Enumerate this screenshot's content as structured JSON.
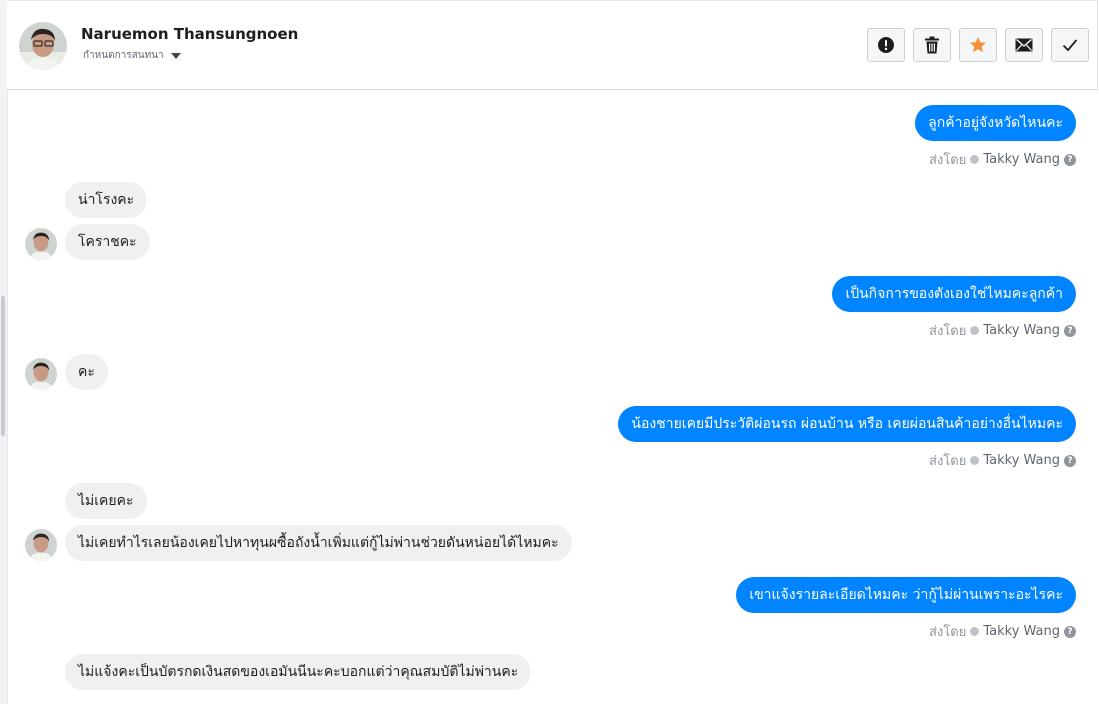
{
  "header": {
    "contact_name": "Naruemon Thansungnoen",
    "assign_label": "กำหนดการสนทนา",
    "actions": [
      {
        "name": "spam",
        "icon": "alert-circle-icon"
      },
      {
        "name": "delete",
        "icon": "trash-icon"
      },
      {
        "name": "star",
        "icon": "star-icon",
        "color": "#f7923b"
      },
      {
        "name": "mark-unread",
        "icon": "envelope-icon"
      },
      {
        "name": "done",
        "icon": "checkmark-icon"
      }
    ]
  },
  "sent_by_prefix": "ส่งโดย",
  "agent_name": "Takky Wang",
  "messages": [
    {
      "dir": "out",
      "text": "ลูกค้าอยู่จังหวัดไหนคะ"
    },
    {
      "dir": "in",
      "text": "น่าโรงคะ"
    },
    {
      "dir": "in",
      "text": "โคราชคะ"
    },
    {
      "dir": "out",
      "text": "เป็นกิจการของตังเองใช่ไหมคะลูกค้า"
    },
    {
      "dir": "in",
      "text": "คะ"
    },
    {
      "dir": "out",
      "text": "น้องชายเคยมีประวัติผ่อนรถ ผ่อนบ้าน หรือ เคยผ่อนสินค้าอย่างอื่นไหมคะ"
    },
    {
      "dir": "in",
      "text": "ไม่เคยคะ"
    },
    {
      "dir": "in",
      "text": "ไม่เคยทำไรเลยน้องเคยไปหาทุนผซื้อถังน้ำเพิ่มแต่กู้ไม่พ่านช่วยดันหน่อยได้ไหมคะ"
    },
    {
      "dir": "out",
      "text": "เขาแจ้งรายละเอียดไหมคะ ว่ากู้ไม่ผ่านเพราะอะไรคะ"
    },
    {
      "dir": "in",
      "text": "ไม่แจ้งคะเป็นบัตรกดเงินสดของเอมันนีนะคะบอกแต่ว่าคุณสมบัติไม่พ่านคะ"
    }
  ]
}
